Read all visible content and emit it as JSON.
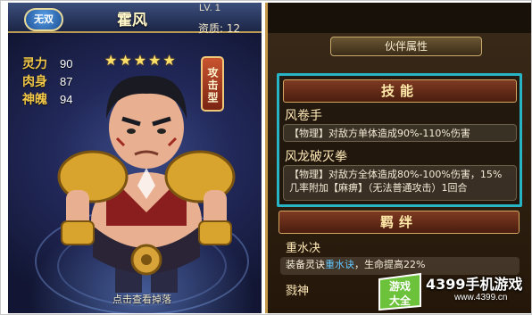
{
  "header": {
    "badge": "无双",
    "name": "霍风",
    "level": "LV. 1",
    "aptitude": "资质: 12"
  },
  "stats": [
    {
      "label": "灵力",
      "value": "90"
    },
    {
      "label": "肉身",
      "value": "87"
    },
    {
      "label": "神魄",
      "value": "94"
    }
  ],
  "stars": 5,
  "type_tag": "攻击型",
  "hint": "点击查看掉落",
  "panel": {
    "title": "伙伴属性",
    "skills_header": "技能",
    "skills": [
      {
        "name": "风卷手",
        "desc": "【物理】对敌方单体造成90%-110%伤害"
      },
      {
        "name": "风龙破灭拳",
        "desc": "【物理】对敌方全体造成80%-100%伤害，15%几率附加【麻痹】（无法普通攻击）1回合"
      }
    ],
    "bonds_header": "羁绊",
    "bonds": [
      {
        "name": "重水决",
        "desc_pre": "装备灵诀",
        "desc_hl": "重水诀",
        "desc_post": "，生命提高22%"
      },
      {
        "name": "戮神"
      }
    ]
  },
  "watermark": {
    "logo_text": "游戏大全",
    "site_name": "4399手机游戏",
    "url": "www.4399.cn"
  },
  "colors": {
    "highlight_border": "#27b5c6",
    "gold": "#f2c84b",
    "link_blue": "#62c6ff"
  }
}
